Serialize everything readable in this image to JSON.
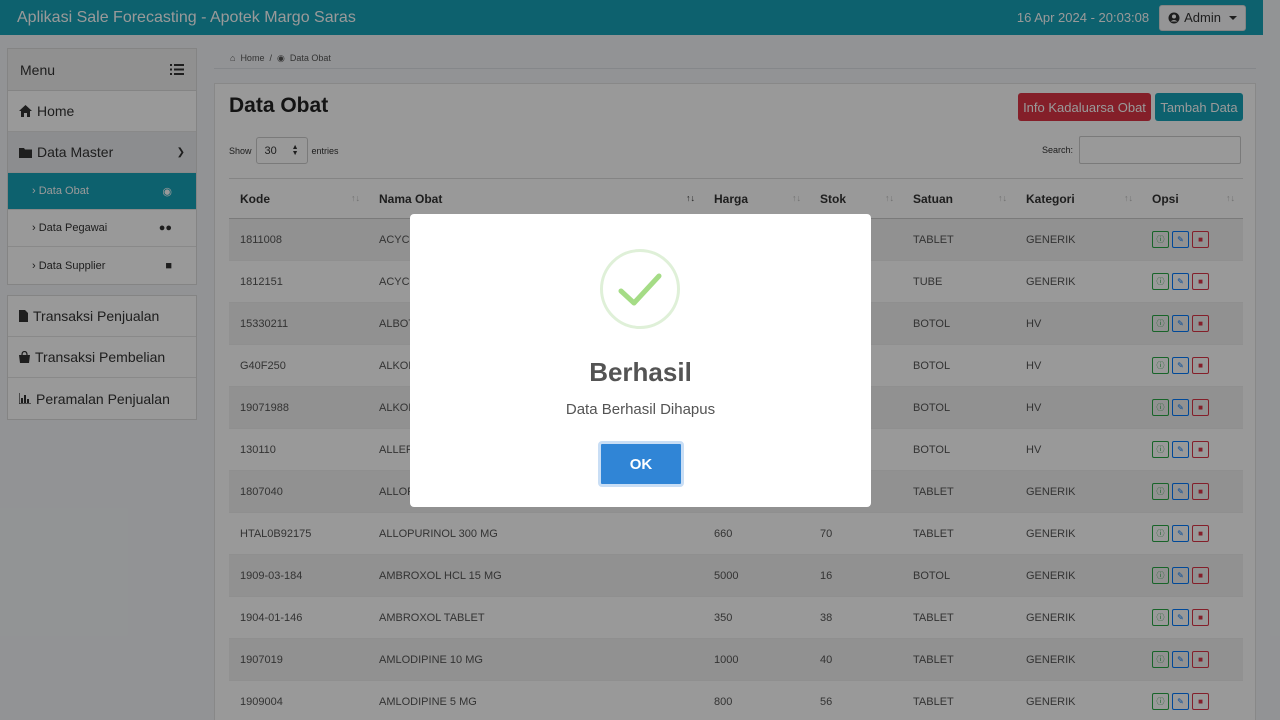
{
  "header": {
    "app_title": "Aplikasi Sale Forecasting - Apotek Margo Saras",
    "datetime": "16 Apr 2024 - 20:03:08",
    "user_label": "Admin"
  },
  "sidebar": {
    "menu_label": "Menu",
    "home": "Home",
    "data_master": "Data Master",
    "sub_items": [
      "Data Obat",
      "Data Pegawai",
      "Data Supplier"
    ],
    "transactions": [
      "Transaksi Penjualan",
      "Transaksi Pembelian",
      "Peramalan Penjualan"
    ]
  },
  "breadcrumb": {
    "home": "Home",
    "current": "Data Obat"
  },
  "main": {
    "title": "Data Obat",
    "btn_expiry": "Info Kadaluarsa Obat",
    "btn_add": "Tambah Data",
    "show_label": "Show",
    "entries_value": "30",
    "entries_label": "entries",
    "search_label": "Search:"
  },
  "table": {
    "columns": [
      "Kode",
      "Nama Obat",
      "Harga",
      "Stok",
      "Satuan",
      "Kategori",
      "Opsi"
    ],
    "rows": [
      [
        "1811008",
        "ACYCL",
        "",
        "",
        "TABLET",
        "GENERIK"
      ],
      [
        "1812151",
        "ACYCL",
        "",
        "",
        "TUBE",
        "GENERIK"
      ],
      [
        "15330211",
        "ALBOT",
        "",
        "",
        "BOTOL",
        "HV"
      ],
      [
        "G40F250",
        "ALKOH",
        "",
        "",
        "BOTOL",
        "HV"
      ],
      [
        "19071988",
        "ALKOH",
        "",
        "",
        "BOTOL",
        "HV"
      ],
      [
        "130110",
        "ALLER",
        "",
        "",
        "BOTOL",
        "HV"
      ],
      [
        "1807040",
        "ALLOP",
        "",
        "",
        "TABLET",
        "GENERIK"
      ],
      [
        "HTAL0B92175",
        "ALLOPURINOL 300 MG",
        "660",
        "70",
        "TABLET",
        "GENERIK"
      ],
      [
        "1909-03-184",
        "AMBROXOL HCL 15 MG",
        "5000",
        "16",
        "BOTOL",
        "GENERIK"
      ],
      [
        "1904-01-146",
        "AMBROXOL TABLET",
        "350",
        "38",
        "TABLET",
        "GENERIK"
      ],
      [
        "1907019",
        "AMLODIPINE 10 MG",
        "1000",
        "40",
        "TABLET",
        "GENERIK"
      ],
      [
        "1909004",
        "AMLODIPINE 5 MG",
        "800",
        "56",
        "TABLET",
        "GENERIK"
      ]
    ]
  },
  "modal": {
    "title": "Berhasil",
    "message": "Data Berhasil Dihapus",
    "ok_label": "OK"
  },
  "colors": {
    "primary": "#17a2b8",
    "danger": "#dc3545",
    "confirm": "#3085d6",
    "success": "#a5dc86"
  }
}
